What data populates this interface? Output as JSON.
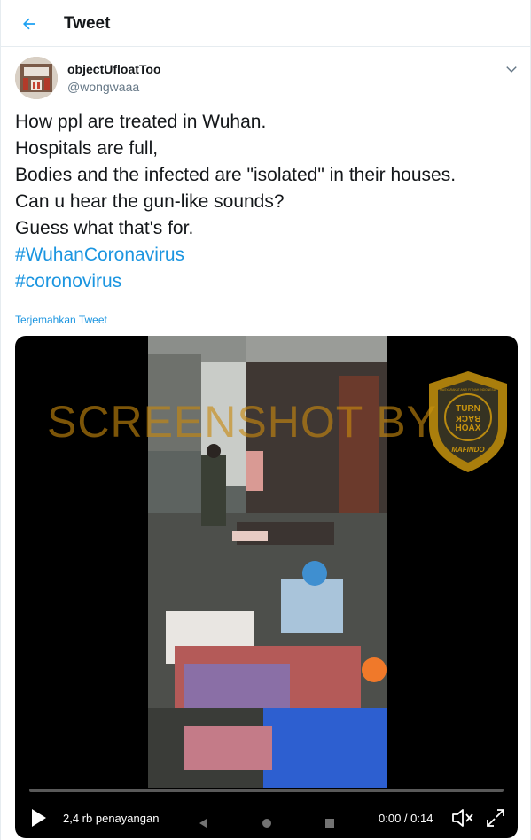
{
  "header": {
    "title": "Tweet",
    "back_icon": "arrow-left-icon",
    "accent": "#1da1f2"
  },
  "tweet": {
    "display_name": "objectUfloatToo",
    "handle": "@wongwaaa",
    "text_lines": [
      "How ppl are treated in Wuhan.",
      "Hospitals are full,",
      "Bodies and the infected are \"isolated\" in their houses.",
      "Can u hear the gun-like sounds?",
      "Guess what that's for."
    ],
    "hashtags": [
      "#WuhanCoronavirus",
      "#coronovirus"
    ],
    "translate_label": "Terjemahkan Tweet",
    "link_color": "#1b95e0"
  },
  "video": {
    "watermark": "SCREENSHOT BY",
    "badge_lines": [
      "TURN",
      "BACK",
      "HOAX"
    ],
    "badge_ring_top": "MASYARAKAT ANTI FITNAH INDONESIA",
    "badge_bottom": "MAFINDO",
    "views_label": "2,4 rb penayangan",
    "time_label": "0:00 / 0:14",
    "progress": 0.0
  }
}
